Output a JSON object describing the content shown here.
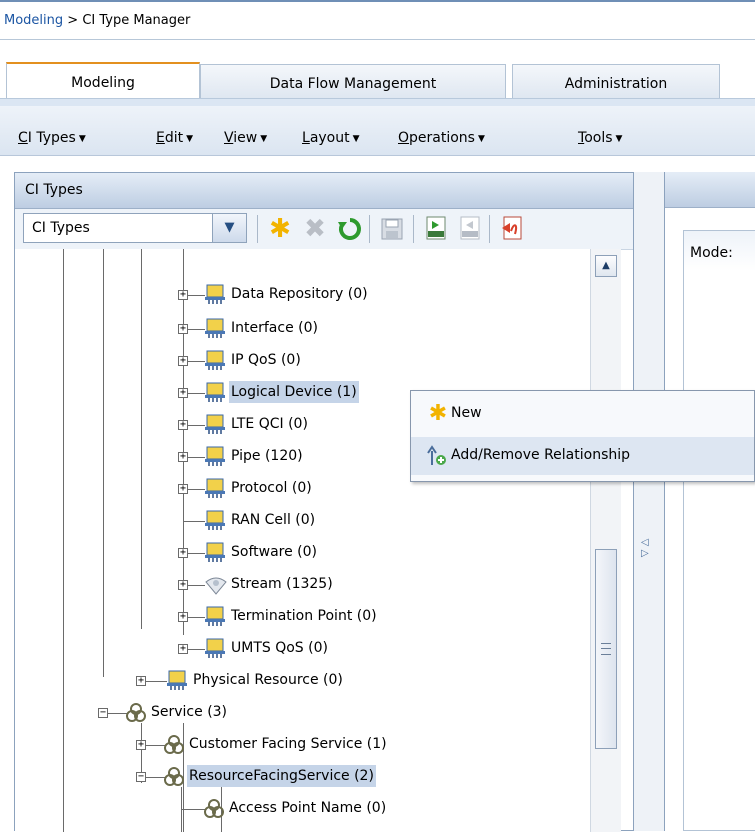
{
  "breadcrumb": {
    "root": "Modeling",
    "separator": " > ",
    "current": "CI Type Manager"
  },
  "tabs": [
    {
      "label": "Modeling",
      "active": true
    },
    {
      "label": "Data Flow Management",
      "active": false
    },
    {
      "label": "Administration",
      "active": false
    }
  ],
  "menubar": [
    {
      "key": "C",
      "rest": "I Types"
    },
    {
      "key": "E",
      "rest": "dit"
    },
    {
      "key": "V",
      "rest": "iew"
    },
    {
      "key": "L",
      "rest": "ayout"
    },
    {
      "key": "O",
      "rest": "perations"
    },
    {
      "key": "T",
      "rest": "ools"
    }
  ],
  "ci_panel": {
    "title": "CI Types",
    "selector_value": "CI Types",
    "toolbar_icons": [
      "new-icon",
      "delete-icon",
      "refresh-icon",
      "save-icon",
      "export-xml-icon",
      "import-xml-icon",
      "pdf-export-icon"
    ]
  },
  "tree": {
    "items": [
      {
        "label": "Data Repository (0)",
        "icon": "monitor-icon",
        "expandable": true
      },
      {
        "label": "Interface (0)",
        "icon": "monitor-icon",
        "expandable": true
      },
      {
        "label": "IP QoS (0)",
        "icon": "monitor-icon",
        "expandable": true
      },
      {
        "label": "Logical Device (1)",
        "icon": "monitor-icon",
        "expandable": true,
        "selected": true
      },
      {
        "label": "LTE QCI (0)",
        "icon": "monitor-icon",
        "expandable": true
      },
      {
        "label": "Pipe (120)",
        "icon": "monitor-icon",
        "expandable": true
      },
      {
        "label": "Protocol (0)",
        "icon": "monitor-icon",
        "expandable": true
      },
      {
        "label": "RAN Cell (0)",
        "icon": "monitor-icon",
        "expandable": false
      },
      {
        "label": "Software (0)",
        "icon": "monitor-icon",
        "expandable": true
      },
      {
        "label": "Stream (1325)",
        "icon": "stream-icon",
        "expandable": true
      },
      {
        "label": "Termination Point (0)",
        "icon": "monitor-icon",
        "expandable": true
      },
      {
        "label": "UMTS QoS (0)",
        "icon": "monitor-icon",
        "expandable": true
      },
      {
        "label": "Physical Resource (0)",
        "icon": "monitor-icon",
        "expandable": true
      },
      {
        "label": "Service (3)",
        "icon": "service-icon",
        "expandable": true,
        "expanded": true
      },
      {
        "label": "Customer Facing Service (1)",
        "icon": "service-icon",
        "expandable": true
      },
      {
        "label": "ResourceFacingService (2)",
        "icon": "service-icon",
        "expandable": true,
        "expanded": true
      },
      {
        "label": "Access Point Name (0)",
        "icon": "service-icon",
        "expandable": false
      }
    ]
  },
  "context_menu": {
    "items": [
      {
        "label": "New",
        "icon": "new-icon"
      },
      {
        "label": "Add/Remove Relationship",
        "icon": "add-relationship-icon"
      }
    ]
  },
  "right_panel": {
    "mode_label": "Mode:"
  },
  "colors": {
    "accent_tab": "#e3901f",
    "selection": "#c5d4e8",
    "link": "#1b55a3"
  }
}
